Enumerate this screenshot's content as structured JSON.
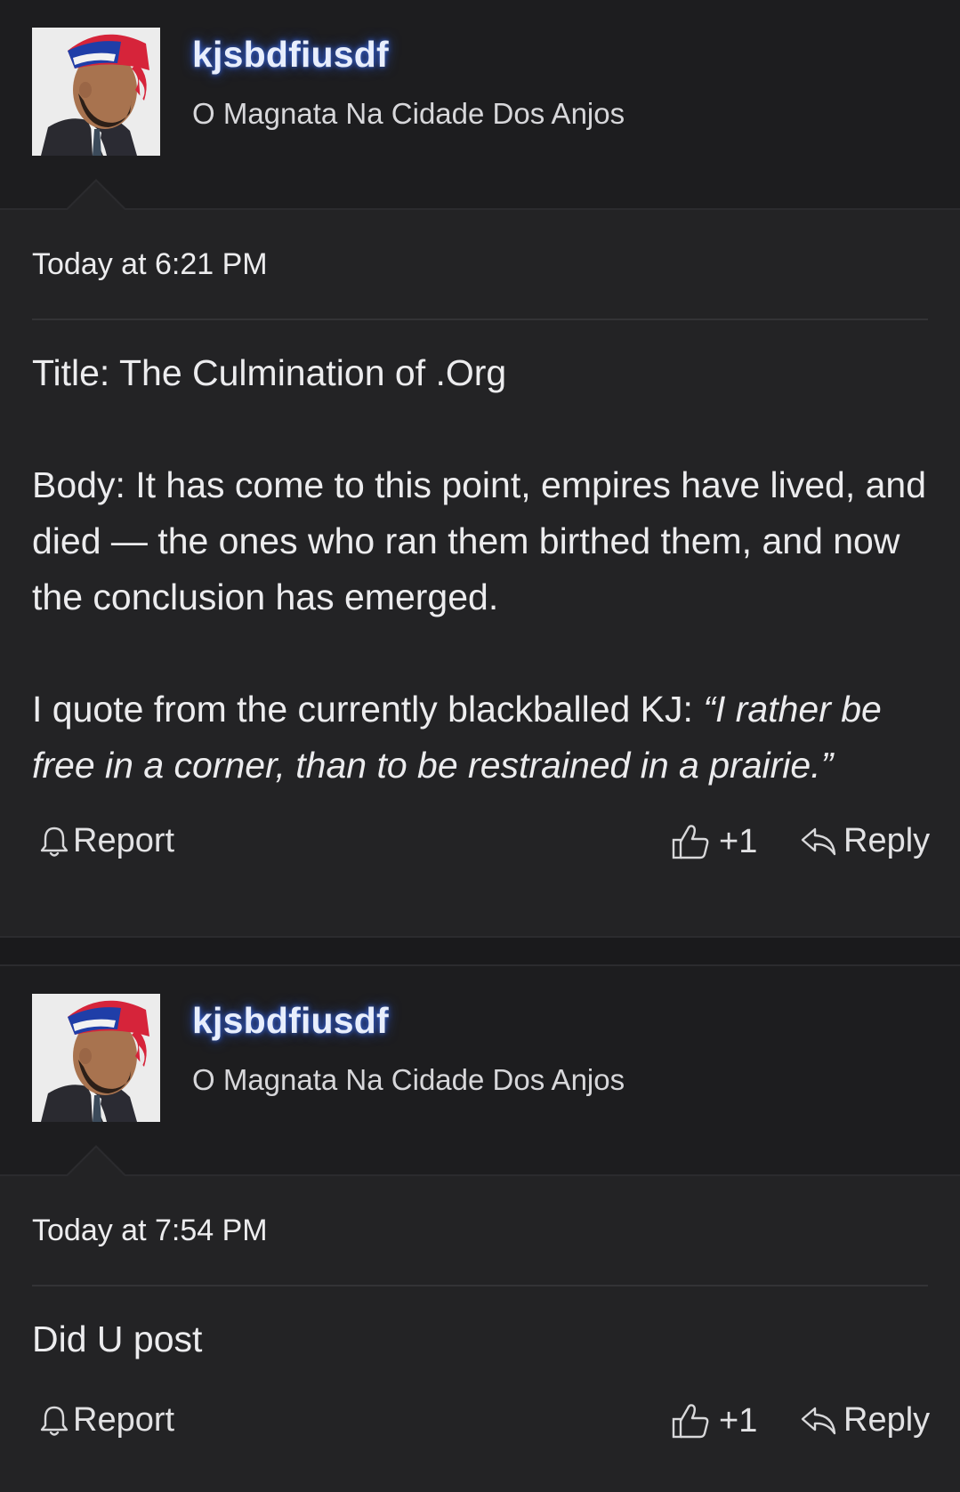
{
  "posts": [
    {
      "username": "kjsbdfiusdf",
      "user_title": "O Magnata Na Cidade Dos Anjos",
      "timestamp": "Today at 6:21 PM",
      "paragraphs": [
        "Title: The Culmination of .Org",
        "Body: It has come to this point, empires have lived, and died — the ones who ran them birthed them, and now the conclusion has emerged."
      ],
      "quote_intro": "I quote from the currently blackballed KJ: ",
      "quote_text": "“I rather be free in a corner, than to be restrained in a prairie.”",
      "report_label": "Report",
      "like_label": "+1",
      "reply_label": "Reply"
    },
    {
      "username": "kjsbdfiusdf",
      "user_title": "O Magnata Na Cidade Dos Anjos",
      "timestamp": "Today at 7:54 PM",
      "paragraphs": [
        "Did U post"
      ],
      "report_label": "Report",
      "like_label": "+1",
      "reply_label": "Reply"
    }
  ],
  "icons": {
    "avatar": "avatar-image",
    "report": "bell-icon",
    "like": "thumbs-up-icon",
    "reply": "reply-arrow-icon"
  },
  "colors": {
    "background": "#1d1d1f",
    "post_background": "#232325",
    "username_glow": "#3a66d8",
    "text": "#ececee"
  }
}
